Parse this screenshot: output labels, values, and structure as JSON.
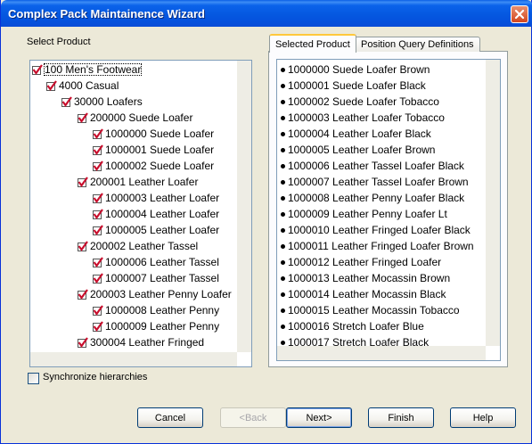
{
  "window": {
    "title": "Complex Pack Maintainence Wizard"
  },
  "left": {
    "label": "Select Product",
    "tree": [
      {
        "label": "100 Men's Footwear",
        "checked": true
      },
      {
        "label": "4000 Casual",
        "checked": true
      },
      {
        "label": "30000 Loafers",
        "checked": true
      },
      {
        "label": "200000 Suede Loafer",
        "checked": true
      },
      {
        "label": "1000000 Suede Loafer",
        "checked": true
      },
      {
        "label": "1000001 Suede Loafer",
        "checked": true
      },
      {
        "label": "1000002 Suede Loafer",
        "checked": true
      },
      {
        "label": "200001 Leather Loafer",
        "checked": true
      },
      {
        "label": "1000003 Leather Loafer",
        "checked": true
      },
      {
        "label": "1000004 Leather Loafer",
        "checked": true
      },
      {
        "label": "1000005 Leather Loafer",
        "checked": true
      },
      {
        "label": "200002 Leather Tassel",
        "checked": true
      },
      {
        "label": "1000006 Leather Tassel",
        "checked": true
      },
      {
        "label": "1000007 Leather Tassel",
        "checked": true
      },
      {
        "label": "200003 Leather Penny Loafer",
        "checked": true
      },
      {
        "label": "1000008 Leather Penny",
        "checked": true
      },
      {
        "label": "1000009 Leather Penny",
        "checked": true
      },
      {
        "label": "300004 Leather Fringed",
        "checked": true
      }
    ],
    "sync_label": "Synchronize hierarchies",
    "sync_checked": false
  },
  "tabs": {
    "selected_product": "Selected Product",
    "position_query": "Position Query Definitions"
  },
  "selected_list": [
    "1000000 Suede Loafer Brown",
    "1000001 Suede Loafer Black",
    "1000002 Suede Loafer Tobacco",
    "1000003 Leather Loafer Tobacco",
    "1000004 Leather Loafer Black",
    "1000005 Leather Loafer Brown",
    "1000006 Leather Tassel Loafer Black",
    "1000007 Leather Tassel Loafer Brown",
    "1000008 Leather Penny Loafer Black",
    "1000009 Leather Penny Loafer Lt",
    "1000010 Leather Fringed Loafer Black",
    "1000011 Leather Fringed Loafer Brown",
    "1000012 Leather Fringed Loafer",
    "1000013 Leather Mocassin Brown",
    "1000014 Leather Mocassin Black",
    "1000015 Leather Mocassin Tobacco",
    "1000016 Stretch Loafer Blue",
    "1000017 Stretch Loafer Black"
  ],
  "buttons": {
    "cancel": "Cancel",
    "back": "<Back",
    "next": "Next>",
    "finish": "Finish",
    "help": "Help"
  },
  "colors": {
    "check_red": "#c8102e",
    "titlebar_blue": "#0558e0",
    "dialog_bg": "#ece9d8"
  }
}
